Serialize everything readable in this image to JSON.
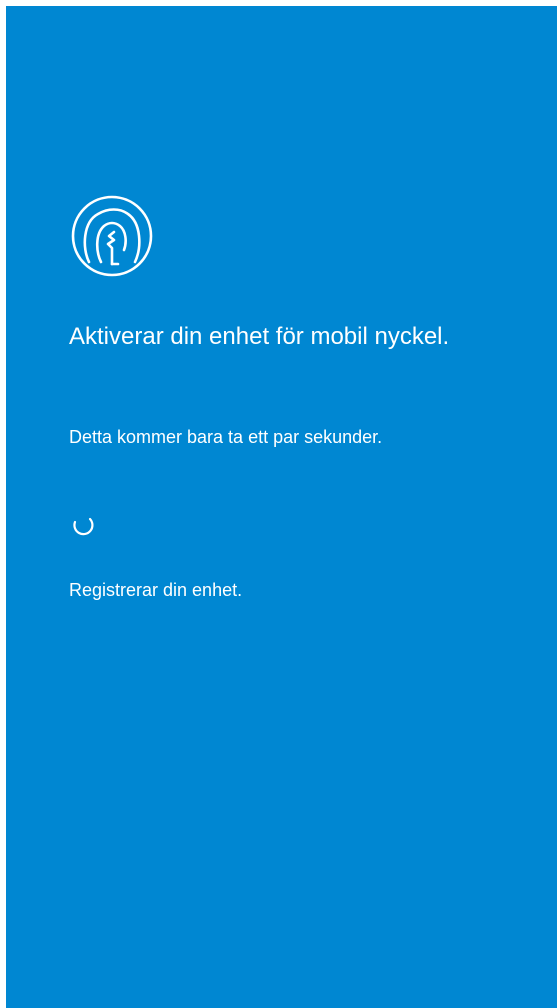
{
  "activation": {
    "title": "Aktiverar din enhet för mobil nyckel.",
    "subtitle": "Detta kommer bara ta ett par sekunder.",
    "status": "Registrerar din enhet."
  },
  "icons": {
    "logo": "tree-circle-logo-icon",
    "spinner": "loading-spinner-icon"
  },
  "colors": {
    "background": "#0087D2",
    "foreground": "#FFFFFF"
  }
}
